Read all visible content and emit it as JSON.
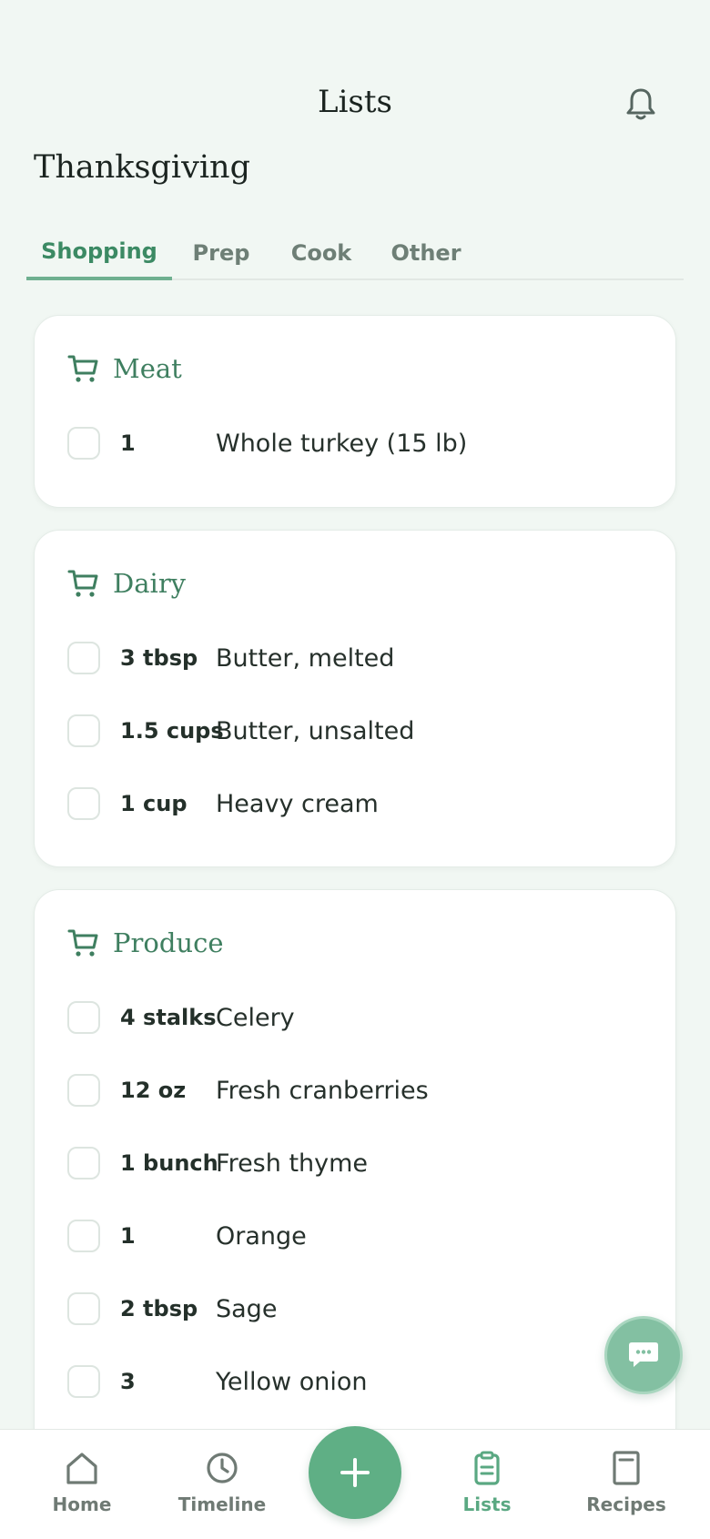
{
  "header": {
    "title": "Lists",
    "list_name": "Thanksgiving"
  },
  "tabs": [
    {
      "label": "Shopping",
      "active": true
    },
    {
      "label": "Prep",
      "active": false
    },
    {
      "label": "Cook",
      "active": false
    },
    {
      "label": "Other",
      "active": false
    }
  ],
  "sections": [
    {
      "title": "Meat",
      "icon": "cart-icon",
      "items": [
        {
          "qty": "1",
          "name": "Whole turkey (15 lb)"
        }
      ]
    },
    {
      "title": "Dairy",
      "icon": "cart-icon",
      "items": [
        {
          "qty": "3 tbsp",
          "name": "Butter, melted"
        },
        {
          "qty": "1.5 cups",
          "name": "Butter, unsalted"
        },
        {
          "qty": "1 cup",
          "name": "Heavy cream"
        }
      ]
    },
    {
      "title": "Produce",
      "icon": "cart-icon",
      "items": [
        {
          "qty": "4 stalks",
          "name": "Celery"
        },
        {
          "qty": "12 oz",
          "name": "Fresh cranberries"
        },
        {
          "qty": "1 bunch",
          "name": "Fresh thyme"
        },
        {
          "qty": "1",
          "name": "Orange"
        },
        {
          "qty": "2 tbsp",
          "name": "Sage"
        },
        {
          "qty": "3",
          "name": "Yellow onion"
        }
      ]
    }
  ],
  "bottom_nav": [
    {
      "label": "Home",
      "icon": "home-icon",
      "active": false
    },
    {
      "label": "Timeline",
      "icon": "clock-icon",
      "active": false
    },
    {
      "label": "Lists",
      "icon": "clipboard-icon",
      "active": true
    },
    {
      "label": "Recipes",
      "icon": "book-icon",
      "active": false
    }
  ],
  "fab": {
    "add_icon": "plus-icon",
    "chat_icon": "chat-icon"
  },
  "colors": {
    "background": "#f1f7f3",
    "accent": "#5faf85",
    "accent_dark": "#3f7f60",
    "chat_fab": "#83c0a2"
  }
}
